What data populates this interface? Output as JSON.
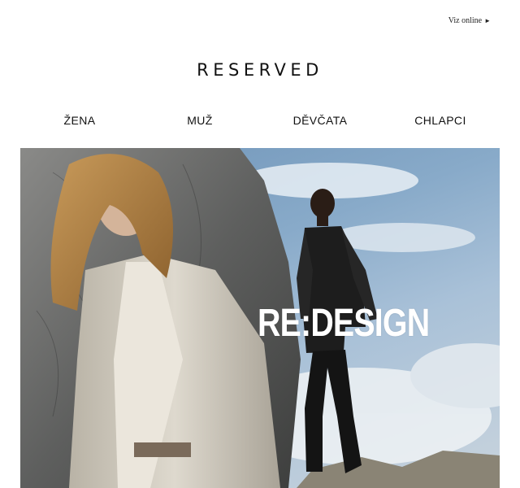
{
  "header": {
    "view_online_label": "Viz online",
    "arrow_glyph": "►",
    "logo_text": "RESERVED"
  },
  "nav": {
    "items": [
      {
        "label": "ŽENA"
      },
      {
        "label": "MUŽ"
      },
      {
        "label": "DĚVČATA"
      },
      {
        "label": "CHLAPCI"
      }
    ]
  },
  "hero": {
    "headline": "RE:DESIGN",
    "colors": {
      "sky": "#88aac9",
      "rock": "#6e6e6e",
      "coat": "#d8d3c8",
      "leather": "#1c1c1c"
    }
  }
}
